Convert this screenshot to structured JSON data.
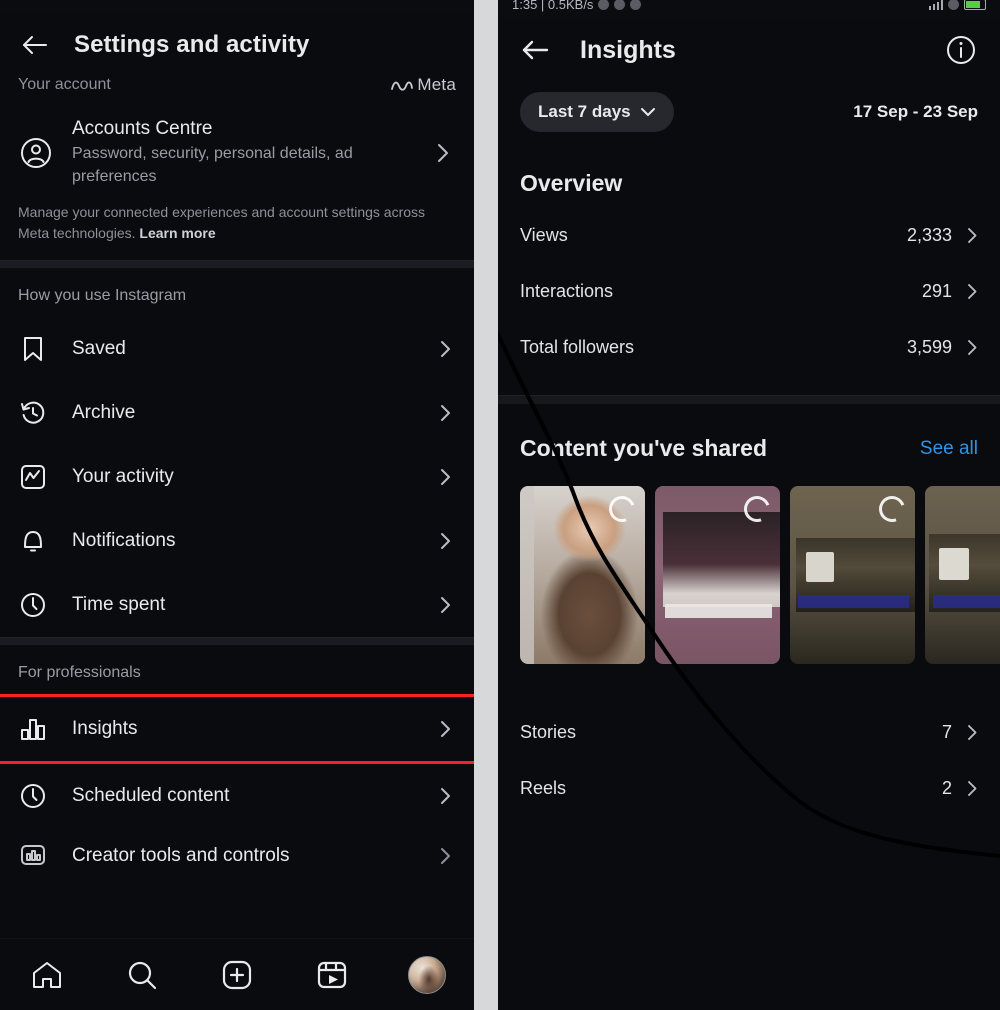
{
  "left": {
    "statusbar": {
      "left_text": "",
      "right_text": ""
    },
    "header": {
      "back_icon": "back-arrow-icon",
      "title": "Settings and activity"
    },
    "subheader": {
      "your_account": "Your account",
      "meta_brand": "Meta"
    },
    "accounts_centre": {
      "icon": "account-circle-icon",
      "title": "Accounts Centre",
      "subtitle": "Password, security, personal details, ad preferences",
      "chevron": "chevron-right-icon"
    },
    "manage_note": {
      "text": "Manage your connected experiences and account settings across Meta technologies. ",
      "link": "Learn more"
    },
    "sections": [
      {
        "label": "How you use Instagram",
        "items": [
          {
            "icon": "bookmark-icon",
            "label": "Saved",
            "chevron": "chevron-right-icon",
            "highlighted": false
          },
          {
            "icon": "archive-clock-icon",
            "label": "Archive",
            "chevron": "chevron-right-icon",
            "highlighted": false
          },
          {
            "icon": "activity-chart-icon",
            "label": "Your activity",
            "chevron": "chevron-right-icon",
            "highlighted": false
          },
          {
            "icon": "bell-icon",
            "label": "Notifications",
            "chevron": "chevron-right-icon",
            "highlighted": false
          },
          {
            "icon": "clock-icon",
            "label": "Time spent",
            "chevron": "chevron-right-icon",
            "highlighted": false
          }
        ]
      },
      {
        "label": "For professionals",
        "items": [
          {
            "icon": "bar-chart-icon",
            "label": "Insights",
            "chevron": "chevron-right-icon",
            "highlighted": true
          },
          {
            "icon": "clock-icon",
            "label": "Scheduled content",
            "chevron": "chevron-right-icon",
            "highlighted": false
          },
          {
            "icon": "creator-tools-icon",
            "label": "Creator tools and controls",
            "chevron": "chevron-right-icon",
            "highlighted": false
          }
        ]
      }
    ],
    "bottom_nav": [
      {
        "icon": "home-icon",
        "label": "Home"
      },
      {
        "icon": "search-icon",
        "label": "Search"
      },
      {
        "icon": "plus-square-icon",
        "label": "Create"
      },
      {
        "icon": "reels-icon",
        "label": "Reels"
      },
      {
        "icon": "avatar",
        "label": "Profile"
      }
    ]
  },
  "right": {
    "statusbar": {
      "left_text": "1:35 | 0.5KB/s",
      "right_text": ""
    },
    "header": {
      "back_icon": "back-arrow-icon",
      "title": "Insights",
      "info_icon": "info-circle-icon"
    },
    "date_filter": {
      "chip_label": "Last 7 days",
      "chip_chevron": "chevron-down-icon",
      "range": "17 Sep - 23 Sep"
    },
    "overview": {
      "title": "Overview",
      "stats": [
        {
          "label": "Views",
          "value": "2,333",
          "chevron": "chevron-right-icon"
        },
        {
          "label": "Interactions",
          "value": "291",
          "chevron": "chevron-right-icon"
        },
        {
          "label": "Total followers",
          "value": "3,599",
          "chevron": "chevron-right-icon"
        }
      ]
    },
    "shared": {
      "title": "Content you've shared",
      "see_all": "See all",
      "see_all_color": "#2f94e8",
      "thumbnails": [
        {
          "name": "content-thumbnail-1",
          "spinner": true
        },
        {
          "name": "content-thumbnail-2",
          "spinner": true
        },
        {
          "name": "content-thumbnail-3",
          "spinner": true
        },
        {
          "name": "content-thumbnail-4",
          "spinner": true
        }
      ],
      "rows": [
        {
          "label": "Stories",
          "value": "7",
          "chevron": "chevron-right-icon"
        },
        {
          "label": "Reels",
          "value": "2",
          "chevron": "chevron-right-icon"
        }
      ]
    }
  },
  "theme": {
    "background": "#0a0b0e",
    "accent_highlight": "#f5212d",
    "link_blue": "#2f94e8",
    "gutter": "#d7d8da"
  }
}
